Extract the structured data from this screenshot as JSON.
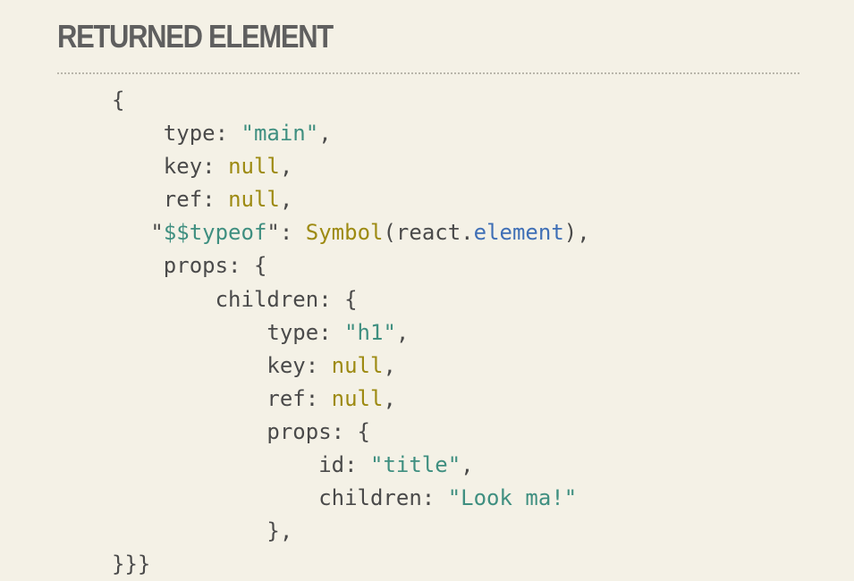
{
  "slide": {
    "title": "RETURNED ELEMENT"
  },
  "code": {
    "l1": {
      "open": "{"
    },
    "l2": {
      "key": "type",
      "sep": ": ",
      "value": "\"main\"",
      "end": ","
    },
    "l3": {
      "key": "key",
      "sep": ": ",
      "value": "null",
      "end": ","
    },
    "l4": {
      "key": "ref",
      "sep": ": ",
      "value": "null",
      "end": ","
    },
    "l5": {
      "q1": "\"",
      "key": "$$typeof",
      "q2": "\"",
      "sep": ": ",
      "symbol": "Symbol",
      "paren_open": "(react.",
      "method": "element",
      "paren_close": ")",
      "end": ","
    },
    "l6": {
      "key": "props",
      "sep": ": ",
      "open": "{"
    },
    "l7": {
      "key": "children",
      "sep": ": ",
      "open": "{"
    },
    "l8": {
      "key": "type",
      "sep": ": ",
      "value": "\"h1\"",
      "end": ","
    },
    "l9": {
      "key": "key",
      "sep": ": ",
      "value": "null",
      "end": ","
    },
    "l10": {
      "key": "ref",
      "sep": ": ",
      "value": "null",
      "end": ","
    },
    "l11": {
      "key": "props",
      "sep": ": ",
      "open": "{"
    },
    "l12": {
      "key": "id",
      "sep": ": ",
      "value": "\"title\"",
      "end": ","
    },
    "l13": {
      "key": "children",
      "sep": ": ",
      "value": "\"Look ma!\""
    },
    "l14": {
      "close": "},"
    },
    "l15": {
      "close": "}}}"
    }
  }
}
